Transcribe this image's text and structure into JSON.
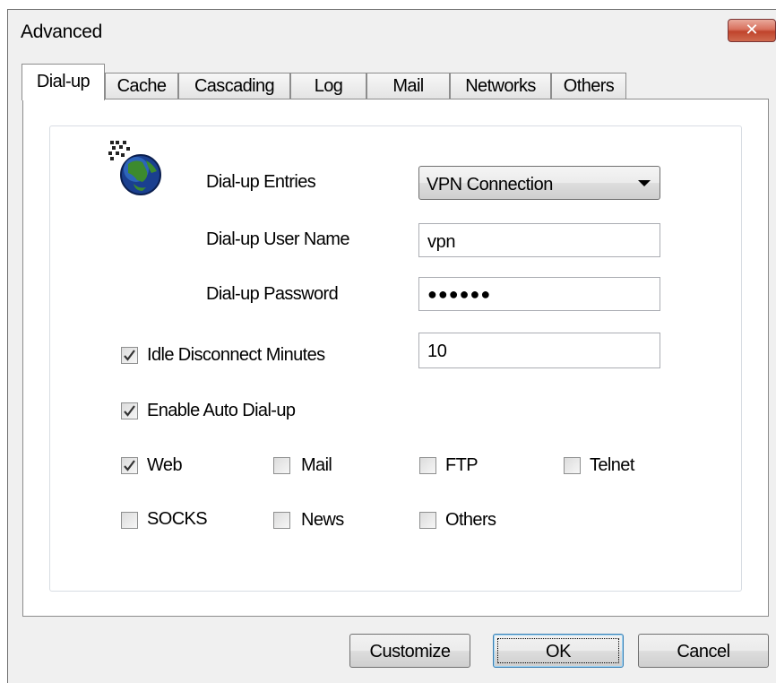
{
  "window": {
    "title": "Advanced",
    "close_glyph": "✕"
  },
  "tabs": [
    {
      "label": "Dial-up",
      "active": true
    },
    {
      "label": "Cache"
    },
    {
      "label": "Cascading"
    },
    {
      "label": "Log"
    },
    {
      "label": "Mail"
    },
    {
      "label": "Networks"
    },
    {
      "label": "Others"
    }
  ],
  "dialup": {
    "icon": "dialup-globe-icon",
    "entries_label": "Dial-up Entries",
    "entries_value": "VPN Connection",
    "user_label": "Dial-up User Name",
    "user_value": "vpn",
    "password_label": "Dial-up Password",
    "password_value": "●●●●●●",
    "idle_label": "Idle Disconnect Minutes",
    "idle_checked": true,
    "idle_value": "10",
    "auto_label": "Enable Auto Dial-up",
    "auto_checked": true
  },
  "protocols": [
    {
      "label": "Web",
      "checked": true
    },
    {
      "label": "Mail",
      "checked": false
    },
    {
      "label": "FTP",
      "checked": false
    },
    {
      "label": "Telnet",
      "checked": false
    },
    {
      "label": "SOCKS",
      "checked": false
    },
    {
      "label": "News",
      "checked": false
    },
    {
      "label": "Others",
      "checked": false
    }
  ],
  "buttons": {
    "customize": "Customize",
    "ok": "OK",
    "cancel": "Cancel"
  }
}
